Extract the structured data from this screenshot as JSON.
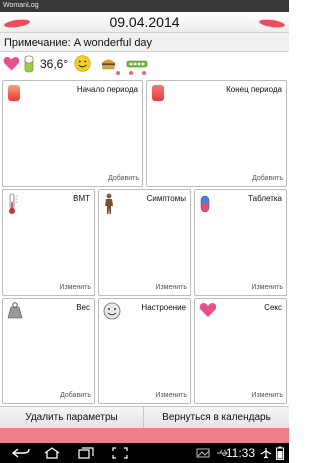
{
  "app": {
    "title": "WomanLog"
  },
  "header": {
    "date": "09.04.2014"
  },
  "note": {
    "text": "Примечание: A wonderful day"
  },
  "summary": {
    "temperature": "36,6°",
    "icons": [
      "heart-icon",
      "pill-pack-icon",
      "smiley-icon",
      "burger-icon",
      "pill-strip-icon"
    ]
  },
  "pager": {
    "page_count": 2
  },
  "tiles": [
    {
      "label": "Начало периода",
      "action": "Добавить",
      "icon": "period-start-drop-icon"
    },
    {
      "label": "Конец периода",
      "action": "Добавить",
      "icon": "period-end-drop-icon"
    },
    {
      "label": "BMT",
      "action": "Изменить",
      "icon": "thermometer-icon"
    },
    {
      "label": "Симптомы",
      "action": "Изменить",
      "icon": "body-figure-icon"
    },
    {
      "label": "Таблетка",
      "action": "Изменить",
      "icon": "pill-capsule-icon"
    },
    {
      "label": "Вес",
      "action": "Добавить",
      "icon": "weight-scale-icon"
    },
    {
      "label": "Настроение",
      "action": "Изменить",
      "icon": "smiley-icon"
    },
    {
      "label": "Секс",
      "action": "Изменить",
      "icon": "heart-icon"
    }
  ],
  "actions": {
    "delete_label": "Удалить параметры",
    "back_label": "Вернуться в календарь"
  },
  "system": {
    "time": "11:33"
  },
  "colors": {
    "accent": "#ee7f88",
    "drop": "#ec4a5e",
    "heart": "#e8508a"
  }
}
